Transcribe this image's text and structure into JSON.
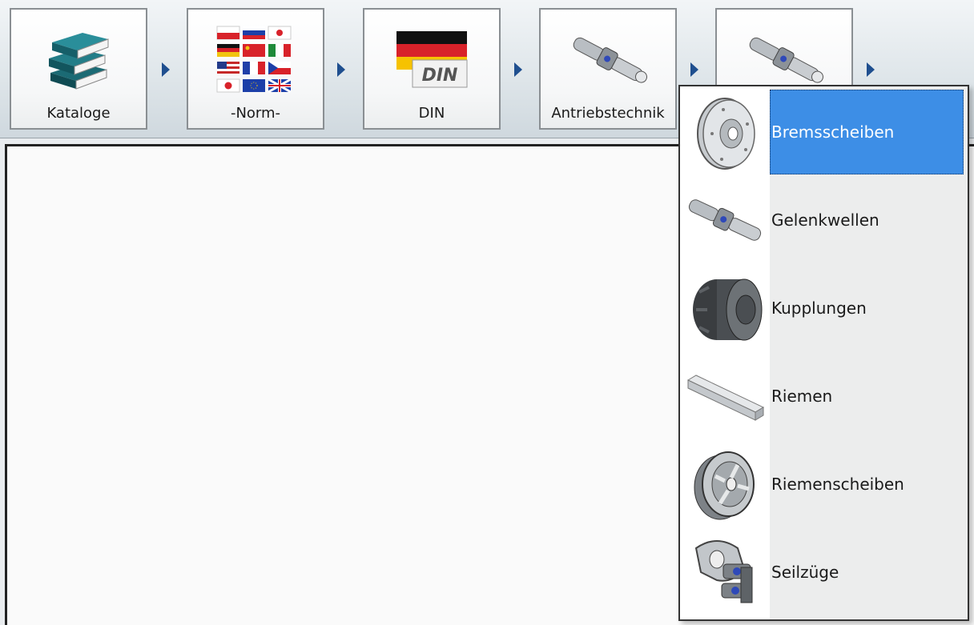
{
  "breadcrumb": [
    {
      "label": "Kataloge",
      "icon": "books-icon"
    },
    {
      "label": "-Norm-",
      "icon": "flags-icon"
    },
    {
      "label": "DIN",
      "icon": "din-flag-icon"
    },
    {
      "label": "Antriebstechnik",
      "icon": "cardan-shaft-icon"
    },
    {
      "label": "",
      "icon": "cardan-shaft-icon"
    }
  ],
  "menu": {
    "items": [
      {
        "label": "Bremsscheiben",
        "icon": "brake-disc-icon",
        "selected": true
      },
      {
        "label": "Gelenkwellen",
        "icon": "cardan-shaft-icon",
        "selected": false
      },
      {
        "label": "Kupplungen",
        "icon": "coupling-icon",
        "selected": false
      },
      {
        "label": "Riemen",
        "icon": "belt-icon",
        "selected": false
      },
      {
        "label": "Riemenscheiben",
        "icon": "pulley-icon",
        "selected": false
      },
      {
        "label": "Seilzüge",
        "icon": "cable-pull-icon",
        "selected": false
      }
    ]
  },
  "colors": {
    "selection": "#3d8ee6",
    "arrow": "#1f4f8f"
  }
}
